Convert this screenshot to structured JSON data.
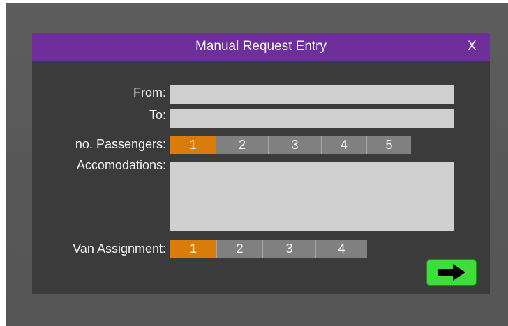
{
  "dialog": {
    "title": "Manual Request Entry",
    "close_label": "X"
  },
  "form": {
    "from_label": "From:",
    "from_value": "",
    "to_label": "To:",
    "to_value": "",
    "passengers_label": "no. Passengers:",
    "passengers_options": [
      "1",
      "2",
      "3",
      "4",
      "5"
    ],
    "passengers_selected": "1",
    "accommodations_label": "Accomodations:",
    "accommodations_value": "",
    "van_label": "Van Assignment:",
    "van_options": [
      "1",
      "2",
      "3",
      "4"
    ],
    "van_selected": "1"
  },
  "actions": {
    "next_icon": "right-arrow-icon"
  },
  "colors": {
    "titlebar": "#6f2f9a",
    "dialog_bg": "#3b3b3b",
    "field_bg": "#d0d0d0",
    "segment_bg": "#808080",
    "selected": "#d97c0a",
    "next_button": "#3fdc3c"
  }
}
